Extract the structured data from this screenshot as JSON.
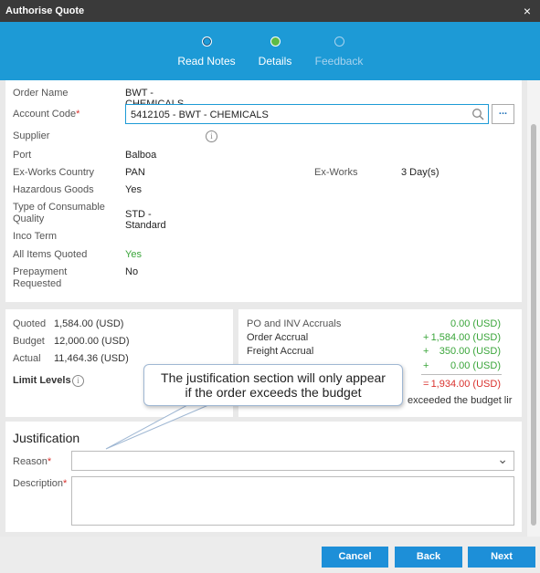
{
  "window": {
    "title": "Authorise Quote",
    "close": "×"
  },
  "steps": [
    {
      "label": "Read Notes"
    },
    {
      "label": "Details"
    },
    {
      "label": "Feedback"
    }
  ],
  "details": {
    "order_name_label": "Order Name",
    "order_name": "BWT - CHEMICALS",
    "account_code_label": "Account Code",
    "account_code": "5412105 - BWT - CHEMICALS",
    "more_label": "...",
    "supplier_label": "Supplier",
    "info_glyph": "i",
    "port_label": "Port",
    "port": "Balboa",
    "ex_works_country_label": "Ex-Works Country",
    "ex_works_country": "PAN",
    "ex_works_label": "Ex-Works",
    "ex_works": "3 Day(s)",
    "hazardous_label": "Hazardous Goods",
    "hazardous": "Yes",
    "consumable_label": "Type of Consumable Quality",
    "consumable": "STD - Standard",
    "inco_label": "Inco Term",
    "all_quoted_label": "All Items Quoted",
    "all_quoted": "Yes",
    "prepayment_label": "Prepayment Requested",
    "prepayment": "No"
  },
  "budget": {
    "quoted_label": "Quoted",
    "quoted": "1,584.00 (USD)",
    "budget_label": "Budget",
    "budget": "12,000.00 (USD)",
    "actual_label": "Actual",
    "actual": "11,464.36 (USD)",
    "limit_label": "Limit Levels"
  },
  "accruals": {
    "title": "PO and INV Accruals",
    "title_value": "0.00 (USD)",
    "order_label": "Order Accrual",
    "order_sign": "+",
    "order_value": "1,584.00 (USD)",
    "freight_label": "Freight Accrual",
    "freight_sign": "+",
    "freight_value": "350.00 (USD)",
    "other_sign": "+",
    "other_value": "0.00 (USD)",
    "total_sign": "=",
    "total_value": "1,934.00 (USD)",
    "exceed_text": "exceeded the budget lir"
  },
  "justification": {
    "title": "Justification",
    "reason_label": "Reason",
    "description_label": "Description",
    "chevron": "⌄"
  },
  "callout": {
    "line1": "The justification section will only appear",
    "line2": "if the order exceeds the budget"
  },
  "buttons": {
    "cancel": "Cancel",
    "back": "Back",
    "next": "Next"
  },
  "colors": {
    "accent": "#1d9ad6",
    "button": "#1d8fd8",
    "green": "#3aa53a",
    "red": "#d9302c",
    "titlebar": "#3a3a3a"
  }
}
